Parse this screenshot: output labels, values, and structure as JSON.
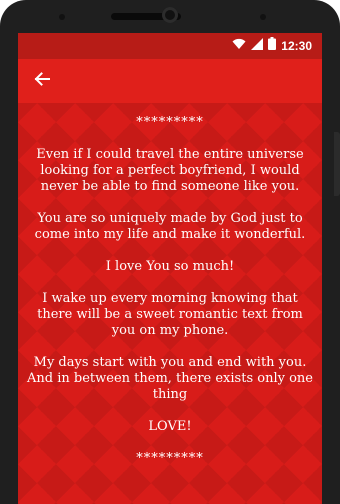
{
  "status_bar": {
    "time": "12:30",
    "icons": [
      "wifi-icon",
      "signal-icon",
      "battery-icon"
    ]
  },
  "app_bar": {
    "back_icon": "arrow-left-icon"
  },
  "message": {
    "top_stars": "*********",
    "paragraphs": [
      "Even if I could travel the entire universe looking for a perfect boyfriend, I would never be able to find someone like you.",
      "You are so uniquely made by God just to come into my life and make it wonderful.",
      "I love You so much!",
      "I wake up every morning knowing that there will be a sweet romantic text from you on my phone.",
      "My days start with you and end with you. And in between them, there exists only one thing",
      "LOVE!"
    ],
    "bottom_stars": "*********"
  },
  "colors": {
    "background_red": "#d81c19",
    "appbar_red": "#e0201b",
    "text": "#ffffff"
  }
}
